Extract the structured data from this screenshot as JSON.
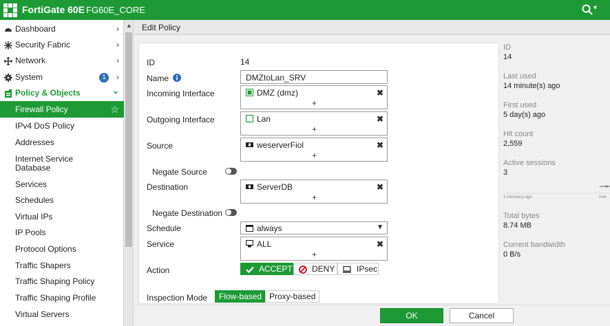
{
  "topbar": {
    "brand": "FortiGate 60E",
    "hostname": "FG60E_CORE",
    "search_caret": "▾"
  },
  "colors": {
    "brand_green": "#1d9a35",
    "badge_blue": "#2f6dba",
    "deny_red": "#d0021b"
  },
  "sidebar": {
    "items": [
      {
        "label": "Dashboard",
        "icon": "dashboard-icon",
        "chev": "›"
      },
      {
        "label": "Security Fabric",
        "icon": "security-fabric-icon",
        "chev": "›"
      },
      {
        "label": "Network",
        "icon": "network-icon",
        "chev": "›"
      },
      {
        "label": "System",
        "icon": "gear-icon",
        "chev": "›",
        "badge": "1"
      },
      {
        "label": "Policy & Objects",
        "icon": "policy-icon",
        "chev": "⌄"
      },
      {
        "label": "Firewall Policy",
        "star": "☆"
      },
      {
        "label": "IPv4 DoS Policy"
      },
      {
        "label": "Addresses"
      },
      {
        "label": "Internet Service Database"
      },
      {
        "label": "Services"
      },
      {
        "label": "Schedules"
      },
      {
        "label": "Virtual IPs"
      },
      {
        "label": "IP Pools"
      },
      {
        "label": "Protocol Options"
      },
      {
        "label": "Traffic Shapers"
      },
      {
        "label": "Traffic Shaping Policy"
      },
      {
        "label": "Traffic Shaping Profile"
      },
      {
        "label": "Virtual Servers"
      }
    ]
  },
  "header": {
    "title": "Edit Policy"
  },
  "form": {
    "id_label": "ID",
    "id_value": "14",
    "name_label": "Name",
    "name_value": "DMZtoLan_SRV",
    "incoming_label": "Incoming Interface",
    "incoming_value": "DMZ (dmz)",
    "outgoing_label": "Outgoing Interface",
    "outgoing_value": "Lan",
    "source_label": "Source",
    "source_value": "weserverFiol",
    "negate_source_label": "Negate Source",
    "destination_label": "Destination",
    "destination_value": "ServerDB",
    "negate_destination_label": "Negate Destination",
    "schedule_label": "Schedule",
    "schedule_value": "always",
    "service_label": "Service",
    "service_value": "ALL",
    "action_label": "Action",
    "accept_label": "ACCEPT",
    "deny_label": "DENY",
    "ipsec_label": "IPsec",
    "inspection_label": "Inspection Mode",
    "flow_label": "Flow-based",
    "proxy_label": "Proxy-based",
    "remove_glyph": "✖",
    "add_glyph": "+"
  },
  "stats": {
    "id_label": "ID",
    "id_value": "14",
    "last_used_label": "Last used",
    "last_used_value": "14 minute(s) ago",
    "first_used_label": "First used",
    "first_used_value": "5 day(s) ago",
    "hit_count_label": "Hit count",
    "hit_count_value": "2,559",
    "active_sessions_label": "Active sessions",
    "active_sessions_value": "3",
    "sparkline_left": "1 minute(s) ago",
    "sparkline_right": "now",
    "total_bytes_label": "Total bytes",
    "total_bytes_value": "8.74 MB",
    "bandwidth_label": "Current bandwidth",
    "bandwidth_value": "0 B/s"
  },
  "footer": {
    "ok_label": "OK",
    "cancel_label": "Cancel"
  }
}
